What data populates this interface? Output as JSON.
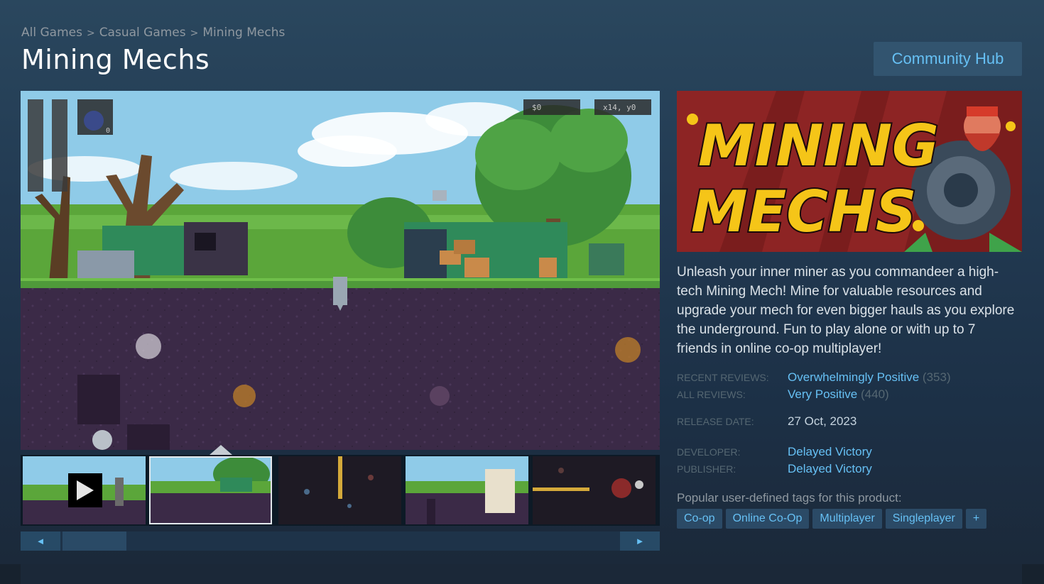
{
  "breadcrumb": {
    "items": [
      "All Games",
      "Casual Games",
      "Mining Mechs"
    ],
    "separator": ">"
  },
  "title": "Mining Mechs",
  "community_hub": "Community Hub",
  "hud": {
    "money": "$0",
    "coords": "x14, y0",
    "bombs": "0"
  },
  "capsule": {
    "logo_line1": "MINING",
    "logo_line2": "MECHS"
  },
  "description": "Unleash your inner miner as you commandeer a high-tech Mining Mech! Mine for valuable resources and upgrade your mech for even bigger hauls as you explore the underground. Fun to play alone or with up to 7 friends in online co-op multiplayer!",
  "reviews": {
    "recent_label": "RECENT REVIEWS:",
    "recent_value": "Overwhelmingly Positive",
    "recent_count": "(353)",
    "all_label": "ALL REVIEWS:",
    "all_value": "Very Positive",
    "all_count": "(440)"
  },
  "release": {
    "label": "RELEASE DATE:",
    "value": "27 Oct, 2023"
  },
  "developer": {
    "label": "DEVELOPER:",
    "value": "Delayed Victory"
  },
  "publisher": {
    "label": "PUBLISHER:",
    "value": "Delayed Victory"
  },
  "tags_label": "Popular user-defined tags for this product:",
  "tags": [
    "Co-op",
    "Online Co-Op",
    "Multiplayer",
    "Singleplayer",
    "+"
  ],
  "scroll": {
    "left": "◄",
    "right": "►"
  },
  "colors": {
    "accent": "#66c0f4",
    "background": "#1b2838",
    "button": "#32546f",
    "logo_yellow": "#f5c518"
  }
}
